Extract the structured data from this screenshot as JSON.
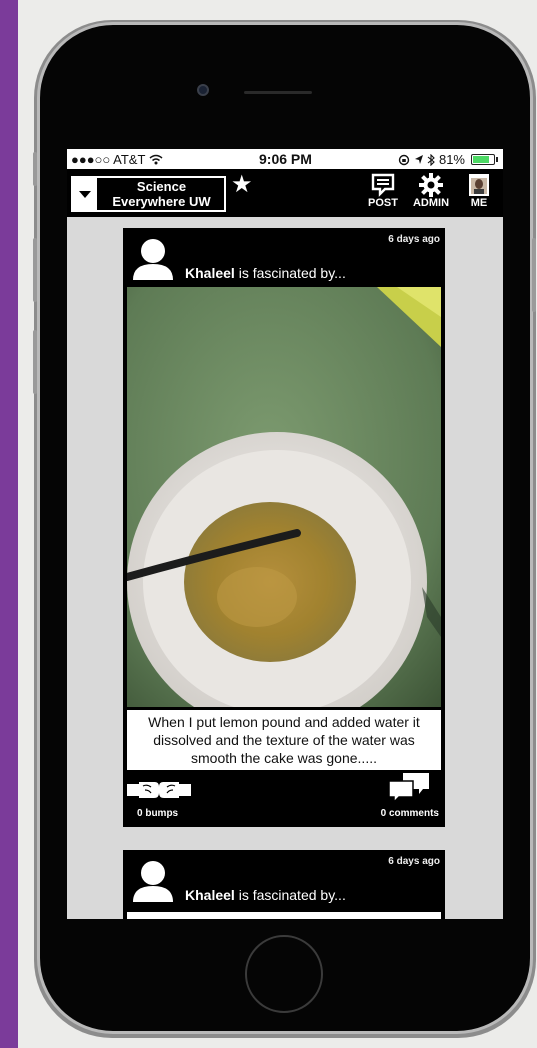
{
  "status_bar": {
    "carrier": "●●●○○ AT&T",
    "time": "9:06 PM",
    "right_status": "81%",
    "battery_level": 0.81
  },
  "header": {
    "group_name_line1": "Science",
    "group_name_line2": "Everywhere UW",
    "post_label": "POST",
    "admin_label": "ADMIN",
    "me_label": "ME"
  },
  "posts": [
    {
      "time_ago": "6 days ago",
      "author": "Khaleel",
      "verb": " is fascinated by...",
      "caption": "When I put lemon pound and added water it dissolved and the texture of the water was smooth the cake was gone.....",
      "bumps": "0 bumps",
      "comments": "0 comments"
    },
    {
      "time_ago": "6 days ago",
      "author": "Khaleel",
      "verb": " is fascinated by..."
    }
  ],
  "colors": {
    "accent_purple": "#7b3b9a",
    "header_bg": "#000000",
    "feed_bg": "#d9d9d9",
    "battery_green": "#4cd964"
  }
}
